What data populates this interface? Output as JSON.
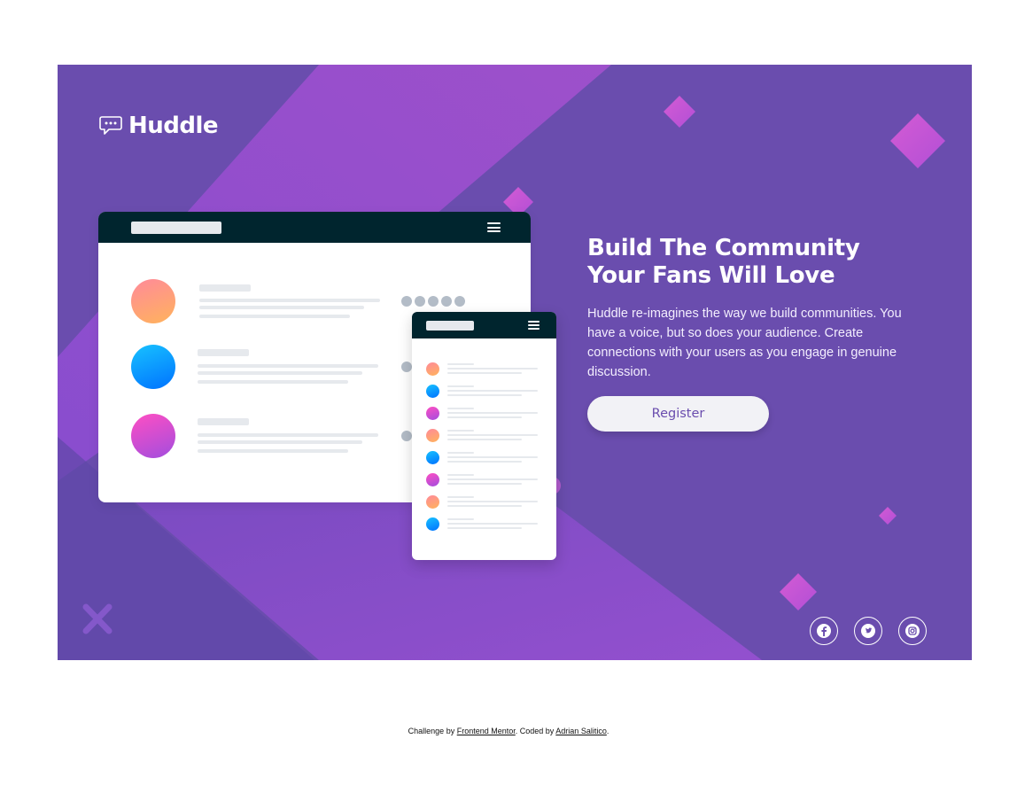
{
  "brand": {
    "name": "Huddle",
    "icon": "chat-bubble-icon"
  },
  "hero": {
    "headline_line1": "Build The Community",
    "headline_line2": "Your Fans Will Love",
    "description": "Huddle re-imagines the way we build communities. You have a voice, but so does your audience. Create connections with your users as you engage in genuine discussion.",
    "register_label": "Register"
  },
  "socials": [
    {
      "name": "facebook",
      "icon": "facebook-icon"
    },
    {
      "name": "twitter",
      "icon": "twitter-icon"
    },
    {
      "name": "instagram",
      "icon": "instagram-icon"
    }
  ],
  "footer": {
    "prefix": "Challenge by ",
    "link1": "Frontend Mentor",
    "middle": ". Coded by ",
    "link2": "Adrian Salitico",
    "suffix": "."
  },
  "colors": {
    "hero_background": "#6a4dae",
    "accent_purple": "#9d4fd1",
    "button_text": "#6a4dae",
    "mockup_bar": "#00252e"
  }
}
